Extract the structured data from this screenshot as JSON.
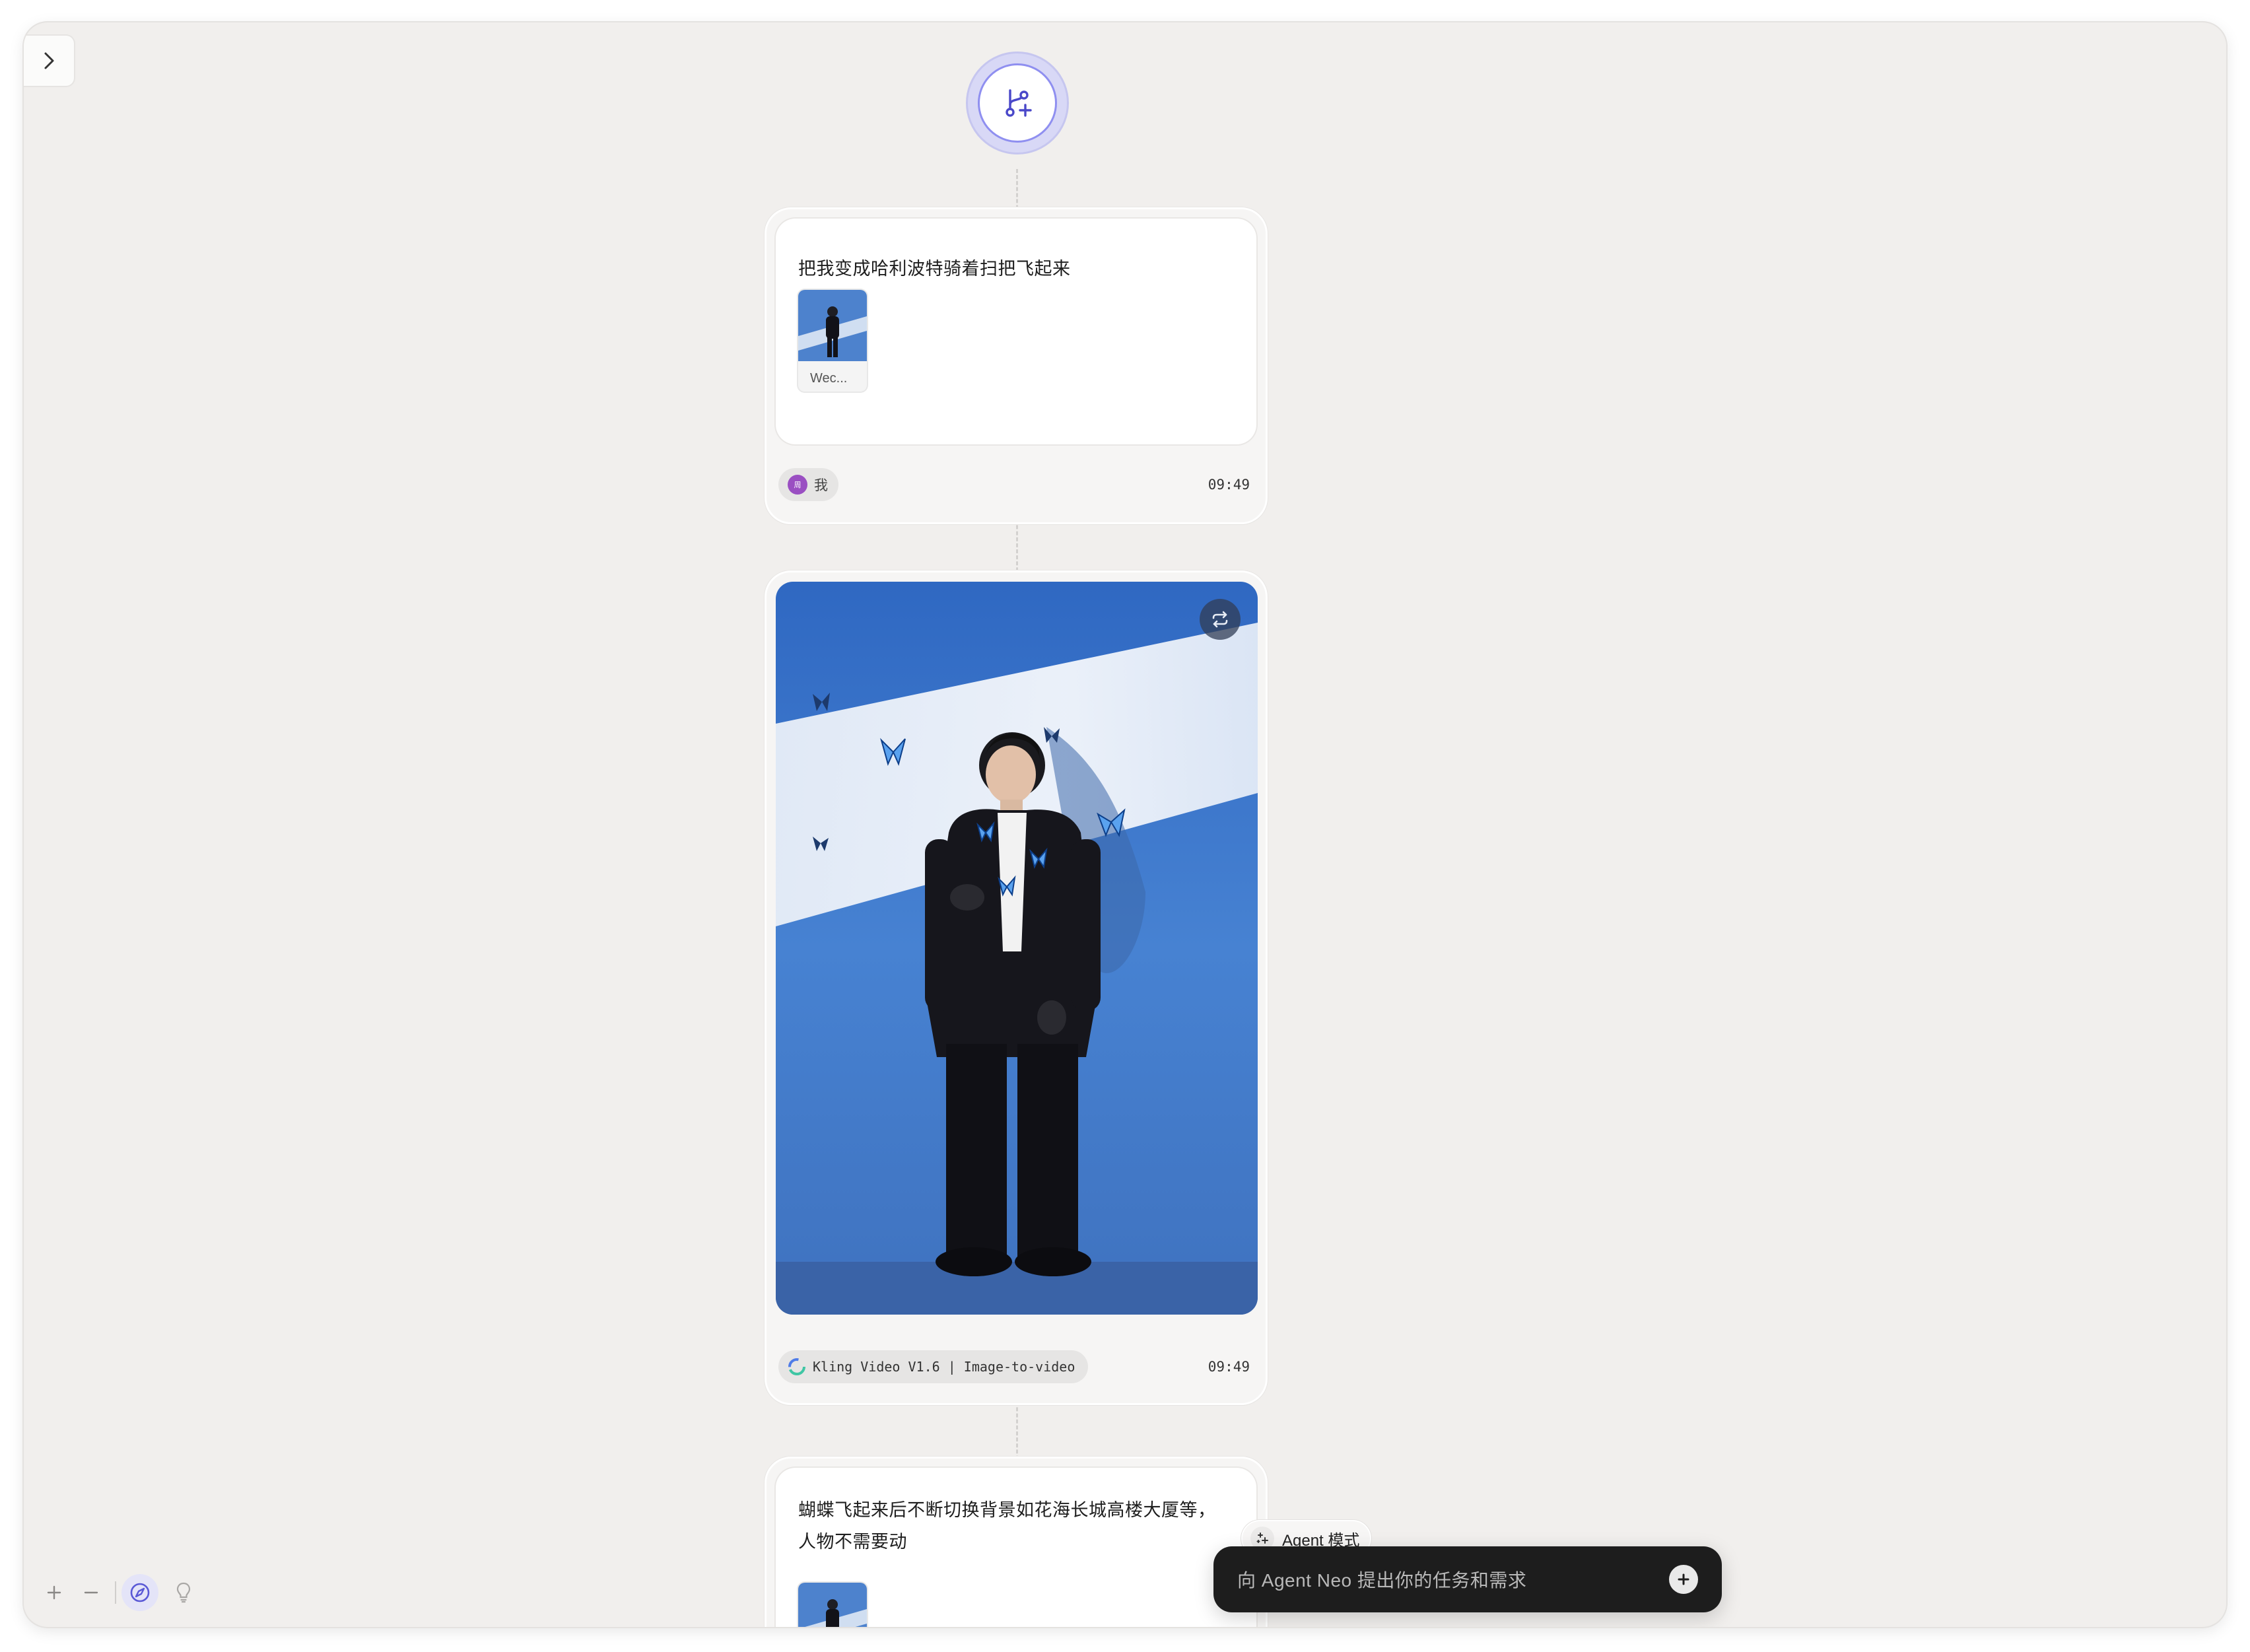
{
  "canvas": {
    "start_node_icon": "branch-plus-icon",
    "sidebar_toggle_icon": "chevron-right-icon"
  },
  "nodes": [
    {
      "prompt": "把我变成哈利波特骑着扫把飞起来",
      "attachment_name": "Wec...",
      "user_initial": "周",
      "user_label": "我",
      "time": "09:49"
    },
    {
      "model_label": "Kling Video V1.6 | Image-to-video",
      "time": "09:49",
      "regen_icon": "repeat-icon"
    },
    {
      "prompt_line1": "蝴蝶飞起来后不断切换背景如花海长城高楼大厦等，",
      "prompt_line2": "人物不需要动"
    }
  ],
  "agent": {
    "mode_label": "Agent 模式",
    "placeholder": "向 Agent Neo 提出你的任务和需求"
  },
  "toolbar": {
    "zoom_in": "+",
    "zoom_out": "−"
  },
  "colors": {
    "canvas_bg": "#f1efed",
    "accent": "#6f6ee8",
    "input_bg": "#1d1d1d"
  }
}
